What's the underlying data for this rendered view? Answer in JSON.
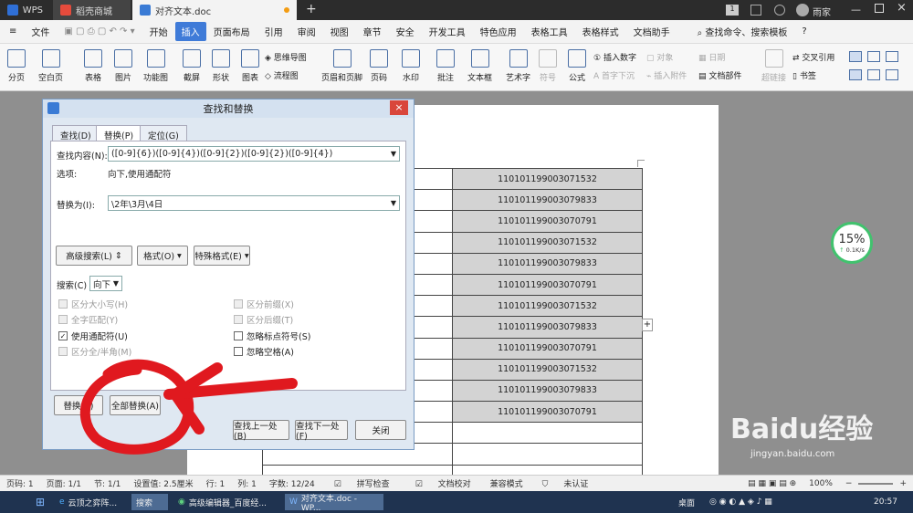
{
  "titlebar": {
    "app": "WPS",
    "tabs": [
      {
        "label": "稻壳商城"
      },
      {
        "label": "对齐文本.doc"
      }
    ],
    "add": "+",
    "badge": "1",
    "user": "雨家"
  },
  "menubar": {
    "file": "文件",
    "items": [
      "开始",
      "插入",
      "页面布局",
      "引用",
      "审阅",
      "视图",
      "章节",
      "安全",
      "开发工具",
      "特色应用",
      "表格工具",
      "表格样式",
      "文档助手"
    ],
    "search": "查找命令、搜索模板",
    "help": "?"
  },
  "ribbon": {
    "buttons": [
      "分页",
      "空白页",
      "表格",
      "图片",
      "功能图",
      "截屏",
      "形状",
      "图表",
      "思维导图",
      "流程图",
      "页眉和页脚",
      "页码",
      "水印",
      "批注",
      "文本框",
      "艺术字",
      "符号",
      "公式",
      "插入数字",
      "对象",
      "首字下沉",
      "日期",
      "插入附件",
      "文档部件",
      "超链接",
      "交叉引用",
      "书签"
    ]
  },
  "document": {
    "ids": [
      "110101199003071532",
      "110101199003079833",
      "110101199003070791",
      "110101199003071532",
      "110101199003079833",
      "110101199003070791",
      "110101199003071532",
      "110101199003079833",
      "110101199003070791",
      "110101199003071532",
      "110101199003079833",
      "110101199003070791"
    ],
    "plus": "+"
  },
  "dialog": {
    "title": "查找和替换",
    "close": "×",
    "tabs": [
      "查找(D)",
      "替换(P)",
      "定位(G)"
    ],
    "find_label": "查找内容(N):",
    "find_value": "([0-9]{6})([0-9]{4})([0-9]{2})([0-9]{2})([0-9]{4})",
    "options_label": "选项:",
    "options_value": "向下,使用通配符",
    "replace_label": "替换为(I):",
    "replace_value": "\\2年\\3月\\4日",
    "btn_advanced": "高级搜索(L)",
    "btn_format": "格式(O)",
    "btn_special": "特殊格式(E)",
    "search_label": "搜索(C)",
    "search_value": "向下",
    "checks_left": [
      {
        "label": "区分大小写(H)",
        "checked": false,
        "enabled": false
      },
      {
        "label": "全字匹配(Y)",
        "checked": false,
        "enabled": false
      },
      {
        "label": "使用通配符(U)",
        "checked": true,
        "enabled": true
      },
      {
        "label": "区分全/半角(M)",
        "checked": false,
        "enabled": false
      }
    ],
    "checks_right": [
      {
        "label": "区分前缀(X)",
        "checked": false,
        "enabled": false
      },
      {
        "label": "区分后缀(T)",
        "checked": false,
        "enabled": false
      },
      {
        "label": "忽略标点符号(S)",
        "checked": false,
        "enabled": true
      },
      {
        "label": "忽略空格(A)",
        "checked": false,
        "enabled": true
      }
    ],
    "btn_replace": "替换(R)",
    "btn_replace_all": "全部替换(A)",
    "btn_find_prev": "查找上一处(B)",
    "btn_find_next": "查找下一处(F)",
    "btn_close": "关闭"
  },
  "speed": {
    "percent": "15%",
    "rate": "0.1K/s"
  },
  "statusbar": {
    "items": [
      "页码: 1",
      "页面: 1/1",
      "节: 1/1",
      "设置值: 2.5厘米",
      "行: 1",
      "列: 1",
      "字数: 12/24",
      "拼写检查",
      "文档校对",
      "兼容模式",
      "未认证"
    ],
    "zoom": "100%"
  },
  "taskbar": {
    "items": [
      "云顶之弈阵...",
      "搜索",
      "高级编辑器_百度经...",
      "对齐文本.doc - WP..."
    ],
    "desktop": "桌面",
    "time": "20:57"
  },
  "watermark": {
    "brand": "Baidu经验",
    "url": "jingyan.baidu.com"
  },
  "colors": {
    "accent": "#3f7bd8",
    "annotation": "#e0191f",
    "titlebar": "#2c2c2c",
    "cell_fill": "#d3d3d3"
  }
}
